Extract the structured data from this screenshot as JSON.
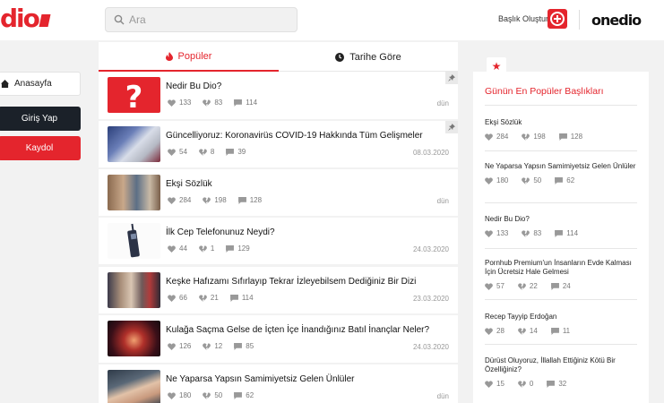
{
  "header": {
    "logo_text": "dio",
    "search_placeholder": "Ara",
    "create_label": "Başlık Oluştur",
    "brand": "onedio"
  },
  "sidebar": {
    "home": "Anasayfa",
    "login": "Giriş Yap",
    "register": "Kaydol"
  },
  "tabs": {
    "popular": "Popüler",
    "by_date": "Tarihe Göre"
  },
  "feed": [
    {
      "title": "Nedir Bu Dio?",
      "likes": "133",
      "dislikes": "83",
      "comments": "114",
      "date": "dün",
      "pinned": true
    },
    {
      "title": "Güncelliyoruz: Koronavirüs COVID-19 Hakkında Tüm Gelişmeler",
      "likes": "54",
      "dislikes": "8",
      "comments": "39",
      "date": "08.03.2020",
      "pinned": true
    },
    {
      "title": "Ekşi Sözlük",
      "likes": "284",
      "dislikes": "198",
      "comments": "128",
      "date": "dün",
      "pinned": false
    },
    {
      "title": "İlk Cep Telefonunuz Neydi?",
      "likes": "44",
      "dislikes": "1",
      "comments": "129",
      "date": "24.03.2020",
      "pinned": false
    },
    {
      "title": "Keşke Hafızamı Sıfırlayıp Tekrar İzleyebilsem Dediğiniz Bir Dizi",
      "likes": "66",
      "dislikes": "21",
      "comments": "114",
      "date": "23.03.2020",
      "pinned": false
    },
    {
      "title": "Kulağa Saçma Gelse de İçten İçe İnandığınız Batıl İnançlar Neler?",
      "likes": "126",
      "dislikes": "12",
      "comments": "85",
      "date": "24.03.2020",
      "pinned": false
    },
    {
      "title": "Ne Yaparsa Yapsın Samimiyetsiz Gelen Ünlüler",
      "likes": "180",
      "dislikes": "50",
      "comments": "62",
      "date": "dün",
      "pinned": false
    }
  ],
  "right_panel": {
    "title": "Günün En Popüler Başlıkları",
    "items": [
      {
        "title": "Ekşi Sözlük",
        "likes": "284",
        "dislikes": "198",
        "comments": "128"
      },
      {
        "title": "Ne Yaparsa Yapsın Samimiyetsiz Gelen Ünlüler",
        "likes": "180",
        "dislikes": "50",
        "comments": "62"
      },
      {
        "title": "Nedir Bu Dio?",
        "likes": "133",
        "dislikes": "83",
        "comments": "114"
      },
      {
        "title": "Pornhub Premium'un İnsanların Evde Kalması İçin Ücretsiz Hale Gelmesi",
        "likes": "57",
        "dislikes": "22",
        "comments": "24"
      },
      {
        "title": "Recep Tayyip Erdoğan",
        "likes": "28",
        "dislikes": "14",
        "comments": "11"
      },
      {
        "title": "Dürüst Oluyoruz, İllallah Ettiğiniz Kötü Bir Özelliğiniz?",
        "likes": "15",
        "dislikes": "0",
        "comments": "32"
      }
    ]
  },
  "colors": {
    "accent": "#e4252d",
    "dark_button": "#1b2129",
    "background": "#f2f2f2"
  }
}
